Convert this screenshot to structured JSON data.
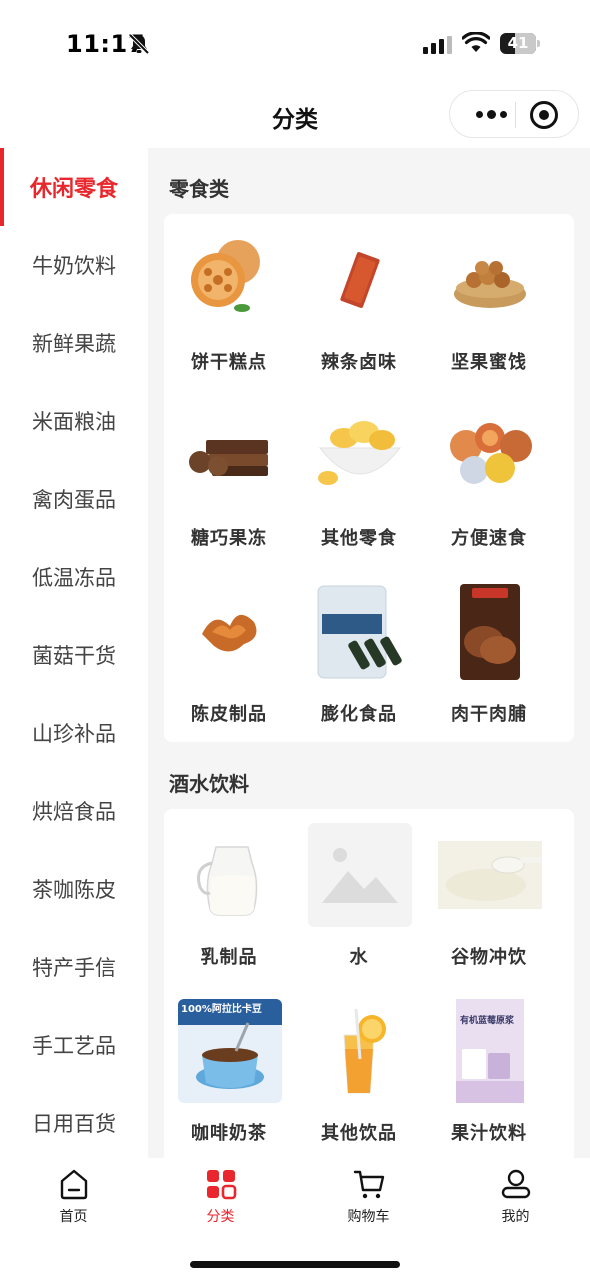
{
  "status_bar": {
    "time": "11:17",
    "battery": "41",
    "battery_level": 0.41,
    "icons": [
      "bell-slash-icon",
      "signal-icon",
      "wifi-icon",
      "battery-icon"
    ]
  },
  "nav": {
    "title": "分类",
    "icons": [
      "more-dots-icon",
      "close-target-icon"
    ]
  },
  "sidebar": {
    "accent_color": "#e8262c",
    "items": [
      {
        "label": "休闲零食",
        "active": true
      },
      {
        "label": "牛奶饮料",
        "active": false
      },
      {
        "label": "新鲜果蔬",
        "active": false
      },
      {
        "label": "米面粮油",
        "active": false
      },
      {
        "label": "禽肉蛋品",
        "active": false
      },
      {
        "label": "低温冻品",
        "active": false
      },
      {
        "label": "菌菇干货",
        "active": false
      },
      {
        "label": "山珍补品",
        "active": false
      },
      {
        "label": "烘焙食品",
        "active": false
      },
      {
        "label": "茶咖陈皮",
        "active": false
      },
      {
        "label": "特产手信",
        "active": false
      },
      {
        "label": "手工艺品",
        "active": false
      },
      {
        "label": "日用百货",
        "active": false
      }
    ]
  },
  "sections": [
    {
      "title": "零食类",
      "items": [
        {
          "label": "饼干糕点",
          "icon": "biscuit-image"
        },
        {
          "label": "辣条卤味",
          "icon": "spicy-strip-image"
        },
        {
          "label": "坚果蜜饯",
          "icon": "nuts-image"
        },
        {
          "label": "糖巧果冻",
          "icon": "chocolate-image"
        },
        {
          "label": "其他零食",
          "icon": "chips-image"
        },
        {
          "label": "方便速食",
          "icon": "instant-food-image"
        },
        {
          "label": "陈皮制品",
          "icon": "dried-peel-image"
        },
        {
          "label": "膨化食品",
          "icon": "puffed-snack-image"
        },
        {
          "label": "肉干肉脯",
          "icon": "jerky-image"
        }
      ]
    },
    {
      "title": "酒水饮料",
      "items": [
        {
          "label": "乳制品",
          "icon": "milk-image"
        },
        {
          "label": "水",
          "icon": "placeholder-image"
        },
        {
          "label": "谷物冲饮",
          "icon": "powder-image"
        },
        {
          "label": "咖啡奶茶",
          "icon": "coffee-image",
          "text": "100%阿拉比卡豆"
        },
        {
          "label": "其他饮品",
          "icon": "juice-glass-image"
        },
        {
          "label": "果汁饮料",
          "icon": "juice-box-image",
          "text": "有机蓝莓原浆"
        }
      ]
    }
  ],
  "tab_bar": {
    "tabs": [
      {
        "label": "首页",
        "icon": "home-icon",
        "active": false
      },
      {
        "label": "分类",
        "icon": "category-icon",
        "active": true
      },
      {
        "label": "购物车",
        "icon": "cart-icon",
        "active": false
      },
      {
        "label": "我的",
        "icon": "user-icon",
        "active": false
      }
    ]
  }
}
